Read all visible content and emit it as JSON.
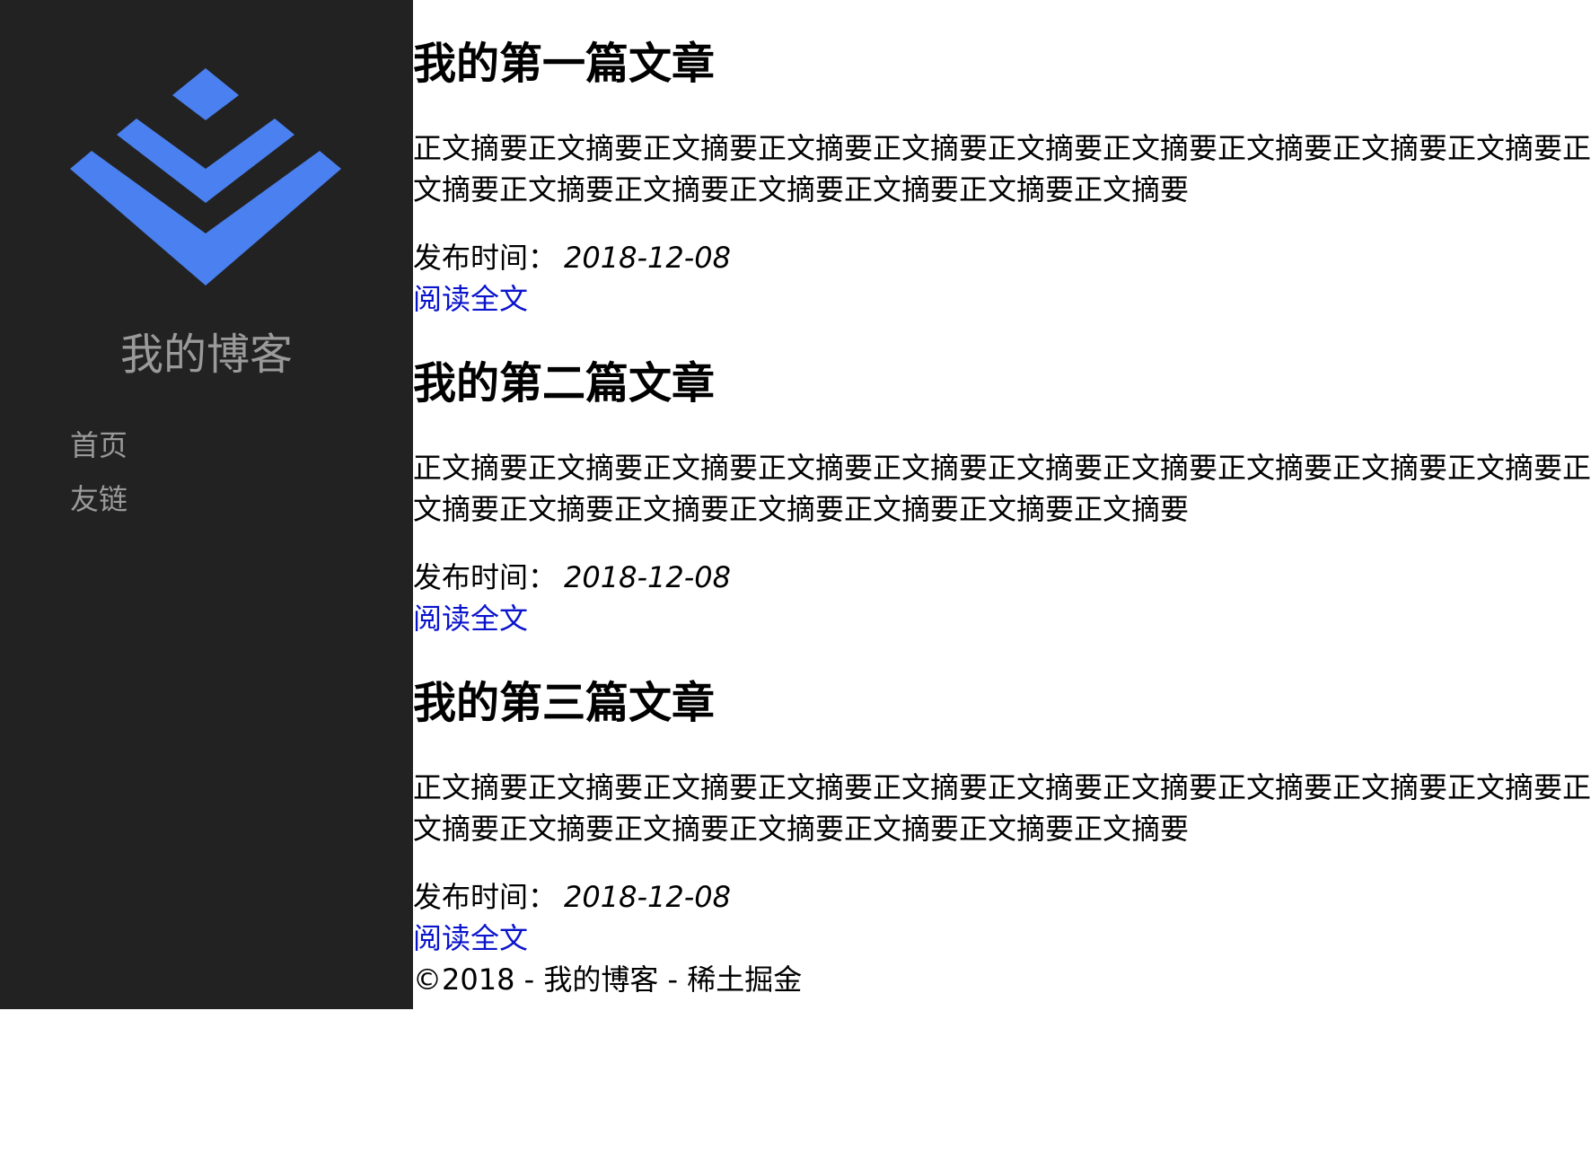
{
  "sidebar": {
    "title": "我的博客",
    "logo_color": "#4a80f0",
    "nav": [
      {
        "label": "首页"
      },
      {
        "label": "友链"
      }
    ]
  },
  "articles": [
    {
      "title": "我的第一篇文章",
      "summary": "正文摘要正文摘要正文摘要正文摘要正文摘要正文摘要正文摘要正文摘要正文摘要正文摘要正文摘要正文摘要正文摘要正文摘要正文摘要正文摘要正文摘要",
      "date_label": "发布时间：",
      "date": "2018-12-08",
      "read_more": "阅读全文"
    },
    {
      "title": "我的第二篇文章",
      "summary": "正文摘要正文摘要正文摘要正文摘要正文摘要正文摘要正文摘要正文摘要正文摘要正文摘要正文摘要正文摘要正文摘要正文摘要正文摘要正文摘要正文摘要",
      "date_label": "发布时间：",
      "date": "2018-12-08",
      "read_more": "阅读全文"
    },
    {
      "title": "我的第三篇文章",
      "summary": "正文摘要正文摘要正文摘要正文摘要正文摘要正文摘要正文摘要正文摘要正文摘要正文摘要正文摘要正文摘要正文摘要正文摘要正文摘要正文摘要正文摘要",
      "date_label": "发布时间：",
      "date": "2018-12-08",
      "read_more": "阅读全文"
    }
  ],
  "footer": {
    "text": "©2018 - 我的博客 - 稀土掘金"
  }
}
